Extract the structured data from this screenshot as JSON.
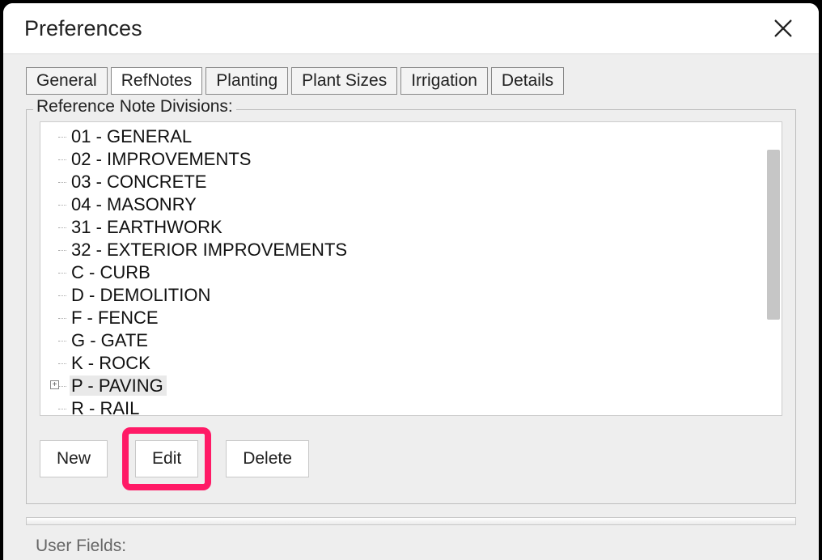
{
  "window": {
    "title": "Preferences"
  },
  "tabs": [
    {
      "label": "General",
      "active": false
    },
    {
      "label": "RefNotes",
      "active": true
    },
    {
      "label": "Planting",
      "active": false
    },
    {
      "label": "Plant Sizes",
      "active": false
    },
    {
      "label": "Irrigation",
      "active": false
    },
    {
      "label": "Details",
      "active": false
    }
  ],
  "divisions": {
    "group_label": "Reference Note Divisions:",
    "items": [
      {
        "label": "01 - GENERAL",
        "expandable": false,
        "selected": false
      },
      {
        "label": "02 - IMPROVEMENTS",
        "expandable": false,
        "selected": false
      },
      {
        "label": "03 - CONCRETE",
        "expandable": false,
        "selected": false
      },
      {
        "label": "04 - MASONRY",
        "expandable": false,
        "selected": false
      },
      {
        "label": "31 - EARTHWORK",
        "expandable": false,
        "selected": false
      },
      {
        "label": "32 - EXTERIOR IMPROVEMENTS",
        "expandable": false,
        "selected": false
      },
      {
        "label": "C - CURB",
        "expandable": false,
        "selected": false
      },
      {
        "label": "D - DEMOLITION",
        "expandable": false,
        "selected": false
      },
      {
        "label": "F - FENCE",
        "expandable": false,
        "selected": false
      },
      {
        "label": "G - GATE",
        "expandable": false,
        "selected": false
      },
      {
        "label": "K - ROCK",
        "expandable": false,
        "selected": false
      },
      {
        "label": "P - PAVING",
        "expandable": true,
        "selected": true
      },
      {
        "label": "R - RAIL",
        "expandable": false,
        "selected": false
      }
    ],
    "buttons": {
      "new": "New",
      "edit": "Edit",
      "delete": "Delete"
    }
  },
  "user_fields": {
    "group_label": "User Fields:"
  },
  "highlight": {
    "target_button": "edit",
    "color": "#ff1a66"
  }
}
